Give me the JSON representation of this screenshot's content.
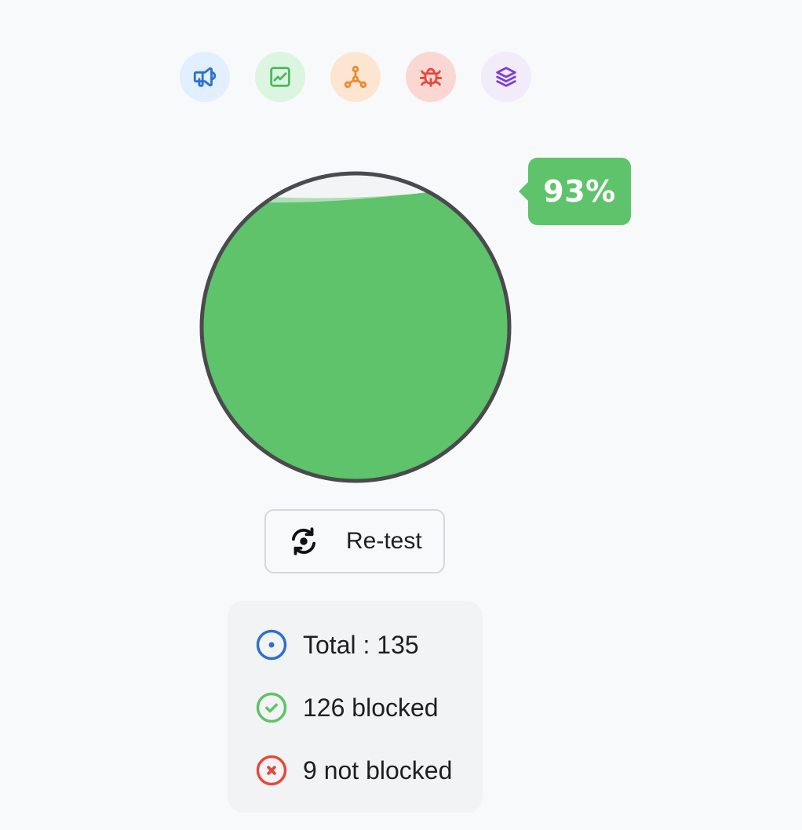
{
  "categories": [
    {
      "name": "megaphone-icon",
      "color": "#2f6fcd",
      "bg": "#e1efff"
    },
    {
      "name": "chart-icon",
      "color": "#4fb85f",
      "bg": "#dcf5e0"
    },
    {
      "name": "nodes-icon",
      "color": "#ec8a2c",
      "bg": "#fde6d1"
    },
    {
      "name": "bug-icon",
      "color": "#e5483c",
      "bg": "#fbd7d4"
    },
    {
      "name": "layers-icon",
      "color": "#7b3fd6",
      "bg": "#f1ebfa"
    }
  ],
  "gauge": {
    "percent": 93,
    "percent_label": "93%",
    "fill_color": "#5ec36a",
    "border_color": "#4a4a4e"
  },
  "retest": {
    "label": "Re-test",
    "icon": "refresh-icon"
  },
  "stats": {
    "total": {
      "label": "Total : 135",
      "icon": "target-icon",
      "color": "#2f6fcd"
    },
    "blocked": {
      "label": "126 blocked",
      "icon": "check-circle-icon",
      "color": "#5ec36a"
    },
    "not_blocked": {
      "label": "9 not blocked",
      "icon": "x-circle-icon",
      "color": "#e5483c"
    }
  }
}
